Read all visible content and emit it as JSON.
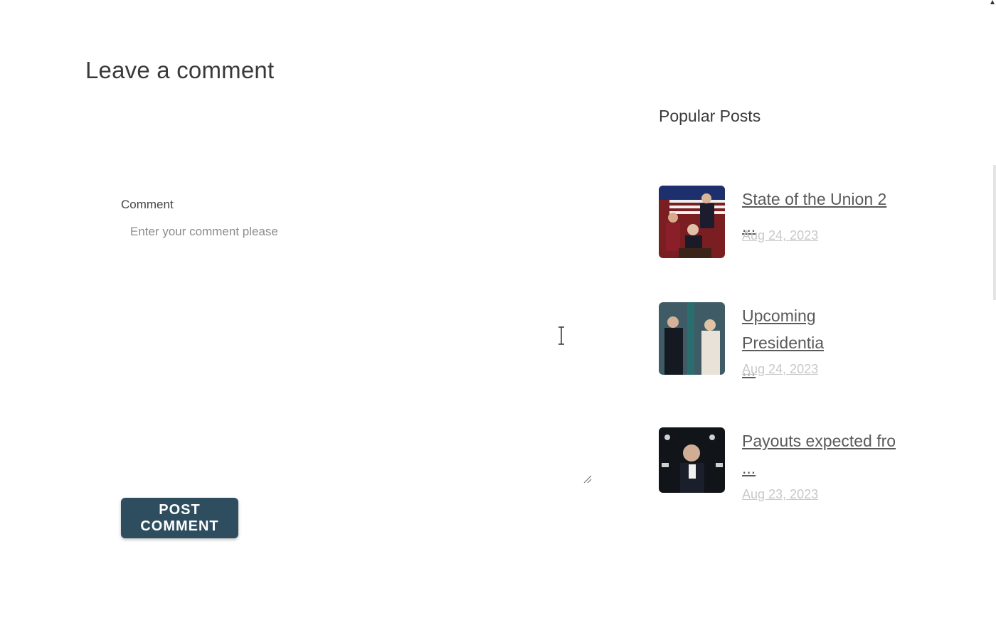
{
  "main": {
    "title": "Leave a comment",
    "comment_label": "Comment",
    "comment_placeholder": "Enter your comment please",
    "post_button": "POST COMMENT"
  },
  "sidebar": {
    "title": "Popular Posts",
    "posts": [
      {
        "title": "State of the Union 2 ...",
        "title_line2": "",
        "date": "Aug 24, 2023"
      },
      {
        "title": "Upcoming Presidentia",
        "title_line2": "...",
        "date": "Aug 24, 2023"
      },
      {
        "title": "Payouts expected fro",
        "title_line2": "...",
        "date": "Aug 23, 2023"
      }
    ]
  },
  "colors": {
    "button_bg": "#2e4d5f",
    "button_text": "#ffffff",
    "date_text": "#c8c8c8"
  }
}
